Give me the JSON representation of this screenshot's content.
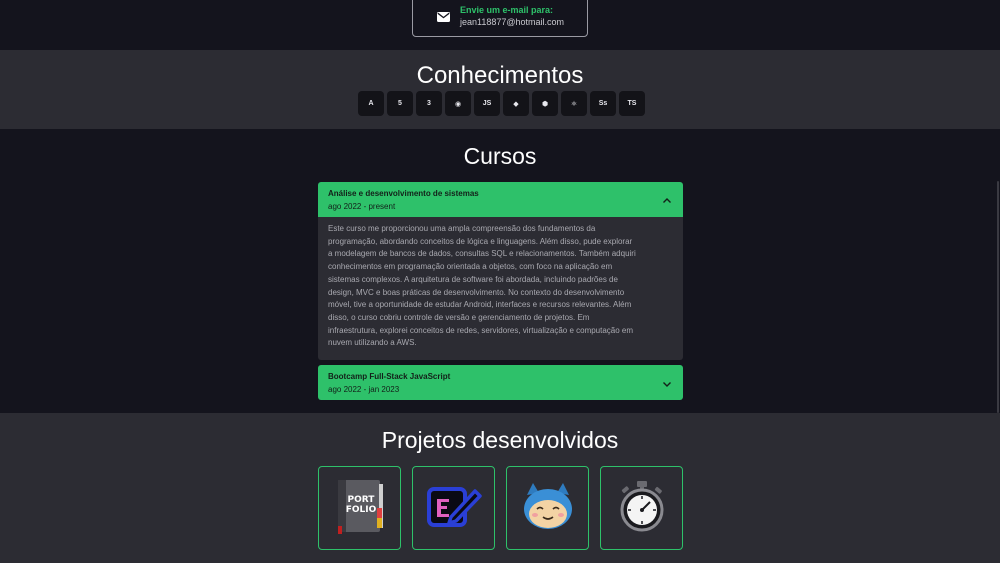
{
  "contact": {
    "label": "Envie um e-mail para:",
    "email": "jean118877@hotmail.com",
    "icon": "envelope-icon"
  },
  "skills": {
    "title": "Conhecimentos",
    "items": [
      {
        "name": "angular-icon",
        "glyph": "A"
      },
      {
        "name": "html5-icon",
        "glyph": "5"
      },
      {
        "name": "css3-icon",
        "glyph": "3"
      },
      {
        "name": "ring-icon",
        "glyph": "◉"
      },
      {
        "name": "javascript-icon",
        "glyph": "JS"
      },
      {
        "name": "mysql-icon",
        "glyph": "◆"
      },
      {
        "name": "nodejs-icon",
        "glyph": "⬢"
      },
      {
        "name": "react-icon",
        "glyph": "⚛"
      },
      {
        "name": "sass-icon",
        "glyph": "Ss"
      },
      {
        "name": "typescript-icon",
        "glyph": "TS"
      }
    ]
  },
  "courses": {
    "title": "Cursos",
    "items": [
      {
        "title": "Análise e desenvolvimento de sistemas",
        "dates": "ago 2022 - present",
        "expanded": true,
        "lines": [
          "Este curso me proporcionou uma ampla compreensão dos fundamentos da",
          "programação, abordando conceitos de lógica e linguagens. Além disso, pude explorar",
          "a modelagem de bancos de dados, consultas SQL e relacionamentos. Também adquiri",
          "conhecimentos em programação orientada a objetos, com foco na aplicação em",
          "sistemas complexos. A arquitetura de software foi abordada, incluindo padrões de",
          "design, MVC e boas práticas de desenvolvimento. No contexto do desenvolvimento",
          "móvel, tive a oportunidade de estudar Android, interfaces e recursos relevantes. Além",
          "disso, o curso cobriu controle de versão e gerenciamento de projetos. Em",
          "infraestrutura, explorei conceitos de redes, servidores, virtualização e computação em",
          "nuvem utilizando a AWS."
        ]
      },
      {
        "title": "Bootcamp Full-Stack JavaScript",
        "dates": "ago 2022 - jan 2023",
        "expanded": false
      }
    ]
  },
  "projects": {
    "title": "Projetos desenvolvidos",
    "portfolio_words": [
      "PORT",
      "FOLIO"
    ],
    "items": [
      {
        "name": "portfolio-project-icon"
      },
      {
        "name": "notes-project-icon"
      },
      {
        "name": "mascot-project-icon"
      },
      {
        "name": "stopwatch-project-icon"
      }
    ]
  },
  "colors": {
    "accent": "#2ec16a",
    "background": "#14141d",
    "band": "#2c2c33"
  }
}
